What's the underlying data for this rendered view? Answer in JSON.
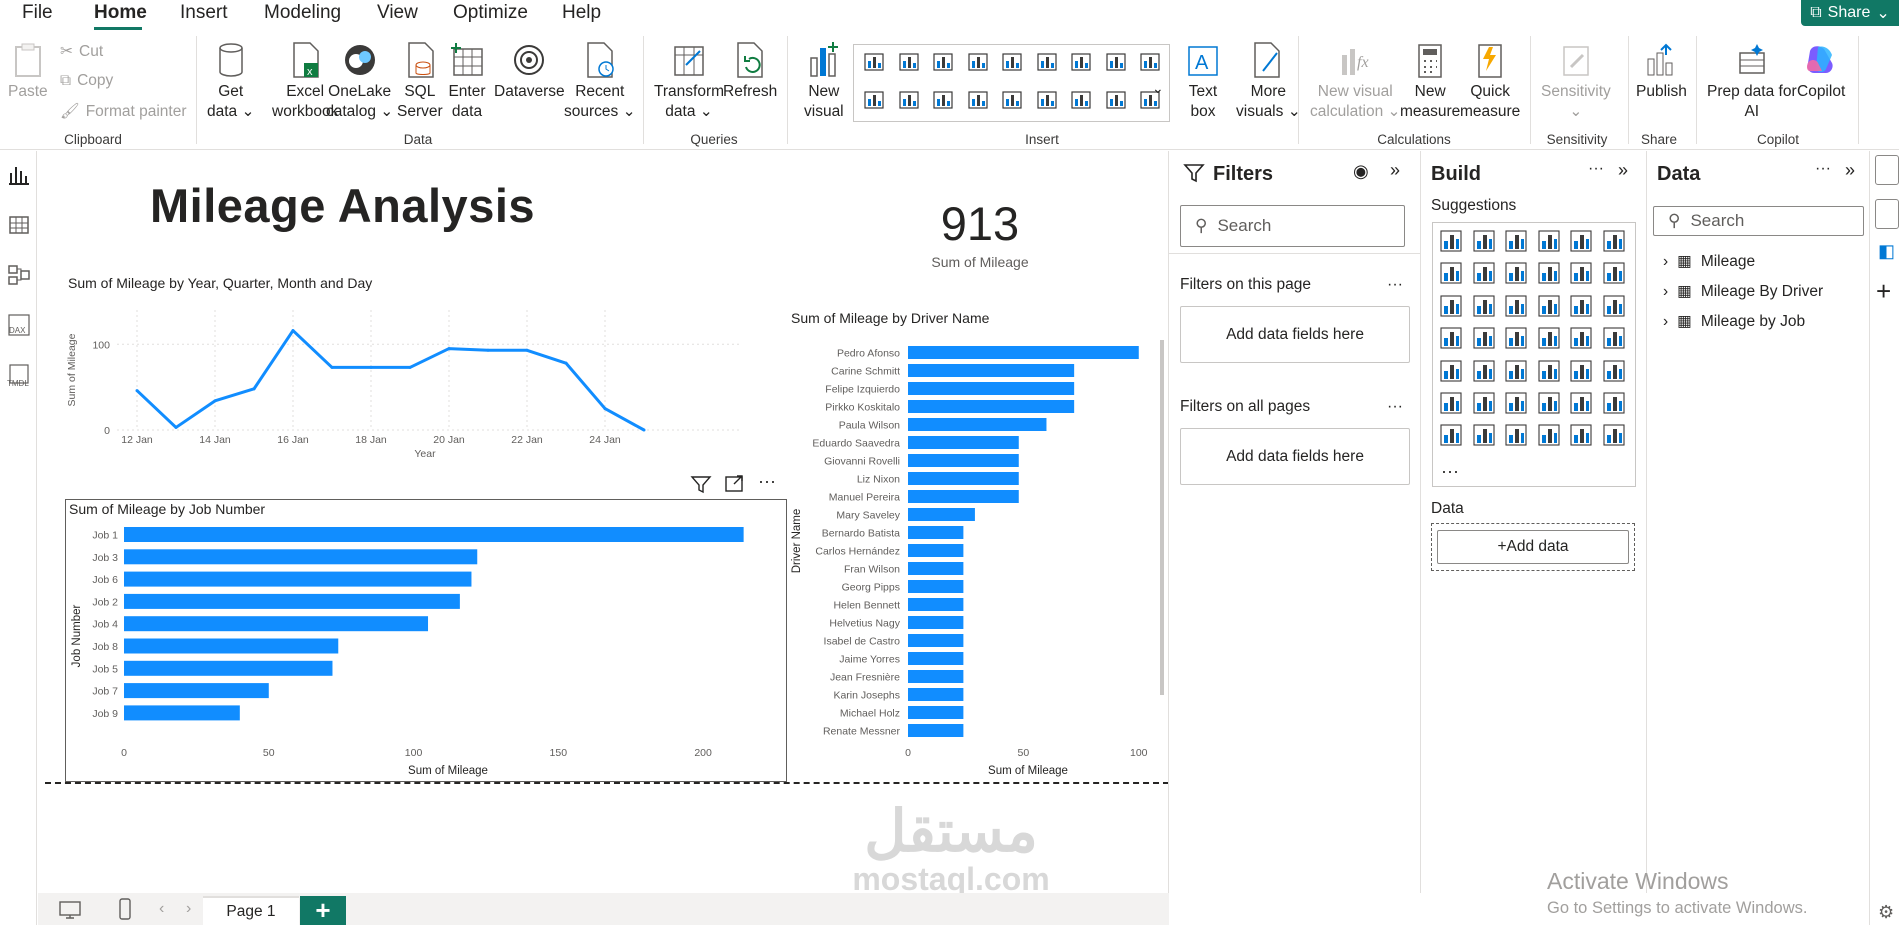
{
  "menu": {
    "file": "File",
    "home": "Home",
    "insert": "Insert",
    "modeling": "Modeling",
    "view": "View",
    "optimize": "Optimize",
    "help": "Help",
    "share": "Share"
  },
  "ribbon": {
    "clipboard": {
      "paste": "Paste",
      "cut": "Cut",
      "copy": "Copy",
      "format_painter": "Format painter",
      "group": "Clipboard"
    },
    "data": {
      "get_data_1": "Get",
      "get_data_2": "data",
      "excel_1": "Excel",
      "excel_2": "workbook",
      "onelake_1": "OneLake",
      "onelake_2": "catalog",
      "sql_1": "SQL",
      "sql_2": "Server",
      "enter_1": "Enter",
      "enter_2": "data",
      "dataverse": "Dataverse",
      "recent_1": "Recent",
      "recent_2": "sources",
      "group": "Data"
    },
    "queries": {
      "transform_1": "Transform",
      "transform_2": "data",
      "refresh": "Refresh",
      "group": "Queries"
    },
    "insert": {
      "new_visual_1": "New",
      "new_visual_2": "visual",
      "text_box_1": "Text",
      "text_box_2": "box",
      "more_visuals_1": "More",
      "more_visuals_2": "visuals",
      "group": "Insert"
    },
    "calculations": {
      "nvc_1": "New visual",
      "nvc_2": "calculation",
      "new_measure_1": "New",
      "new_measure_2": "measure",
      "quick_measure_1": "Quick",
      "quick_measure_2": "measure",
      "group": "Calculations"
    },
    "sensitivity": {
      "label": "Sensitivity",
      "group": "Sensitivity"
    },
    "share": {
      "publish": "Publish",
      "group": "Share"
    },
    "copilot": {
      "prep_1": "Prep data for",
      "prep_2": "AI",
      "copilot": "Copilot",
      "group": "Copilot"
    }
  },
  "report": {
    "title": "Mileage Analysis",
    "card": {
      "value": "913",
      "label": "Sum of Mileage"
    },
    "line_title": "Sum of Mileage by Year, Quarter, Month and Day",
    "job_title": "Sum of Mileage by Job Number",
    "driver_title": "Sum of Mileage by Driver Name"
  },
  "chart_data": [
    {
      "type": "line",
      "title": "Sum of Mileage by Year, Quarter, Month and Day",
      "xlabel": "Year",
      "ylabel": "Sum of Mileage",
      "x": [
        "11 Jan",
        "12 Jan",
        "13 Jan",
        "14 Jan",
        "15 Jan",
        "16 Jan",
        "17 Jan",
        "18 Jan",
        "19 Jan",
        "20 Jan",
        "21 Jan",
        "22 Jan",
        "23 Jan",
        "24 Jan",
        "25 Jan"
      ],
      "xticks": [
        "12 Jan",
        "14 Jan",
        "16 Jan",
        "18 Jan",
        "20 Jan",
        "22 Jan",
        "24 Jan"
      ],
      "values": [
        73,
        46,
        3,
        34,
        48,
        116,
        73,
        73,
        73,
        95,
        93,
        93,
        78,
        25,
        0
      ],
      "yticks": [
        0,
        100
      ],
      "ylim": [
        0,
        140
      ],
      "color": "#118DFF"
    },
    {
      "type": "bar",
      "orientation": "horizontal",
      "title": "Sum of Mileage by Job Number",
      "xlabel": "Sum of Mileage",
      "ylabel": "Job Number",
      "categories": [
        "Job 1",
        "Job 3",
        "Job 6",
        "Job 2",
        "Job 4",
        "Job 8",
        "Job 5",
        "Job 7",
        "Job 9"
      ],
      "values": [
        214,
        122,
        120,
        116,
        105,
        74,
        72,
        50,
        40
      ],
      "xticks": [
        0,
        50,
        100,
        150,
        200
      ],
      "xlim": [
        0,
        220
      ],
      "color": "#118DFF"
    },
    {
      "type": "bar",
      "orientation": "horizontal",
      "title": "Sum of Mileage by Driver Name",
      "xlabel": "Sum of Mileage",
      "ylabel": "Driver Name",
      "categories": [
        "Pedro Afonso",
        "Carine Schmitt",
        "Felipe Izquierdo",
        "Pirkko Koskitalo",
        "Paula Wilson",
        "Eduardo Saavedra",
        "Giovanni Rovelli",
        "Liz Nixon",
        "Manuel Pereira",
        "Mary Saveley",
        "Bernardo Batista",
        "Carlos Hernández",
        "Fran Wilson",
        "Georg Pipps",
        "Helen Bennett",
        "Helvetius Nagy",
        "Isabel de Castro",
        "Jaime Yorres",
        "Jean Fresnière",
        "Karin Josephs",
        "Michael Holz",
        "Renate Messner"
      ],
      "values": [
        100,
        72,
        72,
        72,
        60,
        48,
        48,
        48,
        48,
        29,
        24,
        24,
        24,
        24,
        24,
        24,
        24,
        24,
        24,
        24,
        24,
        24
      ],
      "xticks": [
        0,
        50,
        100
      ],
      "xlim": [
        0,
        104
      ],
      "color": "#118DFF"
    }
  ],
  "filters": {
    "title": "Filters",
    "search": "Search",
    "on_page": "Filters on this page",
    "add1": "Add data fields here",
    "on_all": "Filters on all pages",
    "add2": "Add data fields here"
  },
  "build": {
    "title": "Build",
    "suggestions": "Suggestions",
    "data_label": "Data",
    "add_data": "+Add data"
  },
  "data_pane": {
    "title": "Data",
    "search": "Search",
    "tables": [
      "Mileage",
      "Mileage By Driver",
      "Mileage by Job"
    ]
  },
  "pages": {
    "page1": "Page 1",
    "add": "+"
  },
  "system": {
    "activate": "Activate Windows",
    "activate_sub": "Go to Settings to activate Windows."
  },
  "watermark": {
    "arabic": "مستقل",
    "latin": "mostaql.com"
  }
}
